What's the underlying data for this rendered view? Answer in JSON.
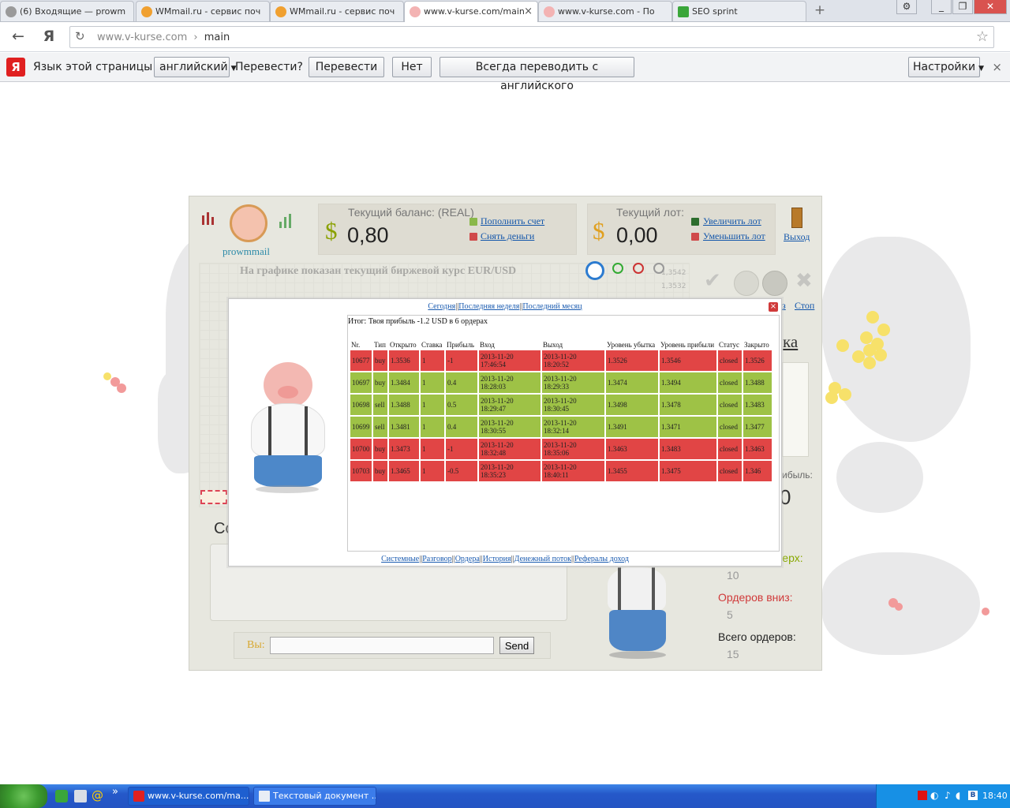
{
  "browser": {
    "tabs": [
      {
        "label": "(6) Входящие — prowm",
        "icon_color": "#8a8a8a"
      },
      {
        "label": "WMmail.ru - сервис поч",
        "icon_color": "#f0a030"
      },
      {
        "label": "WMmail.ru - сервис поч",
        "icon_color": "#f0a030"
      },
      {
        "label": "www.v-kurse.com/main",
        "icon_color": "#f3b3b3",
        "close": "×"
      },
      {
        "label": "www.v-kurse.com - По",
        "icon_color": "#f3b3b3"
      },
      {
        "label": "SEO sprint",
        "icon_color": "#3aa63a"
      }
    ],
    "new_tab": "+",
    "window_buttons": {
      "settings": "⚙",
      "minimize": "_",
      "restore": "❐",
      "close": "✕"
    },
    "nav": {
      "back": "←",
      "yandex": "Я",
      "reload": "↻"
    },
    "address": {
      "host": "www.v-kurse.com",
      "separator": "›",
      "path": "main",
      "star": "☆"
    },
    "translate": {
      "logo": "Я",
      "prompt": "Язык этой страницы –",
      "language": "английский",
      "question": "Перевести?",
      "translate_btn": "Перевести",
      "no_btn": "Нет",
      "always_btn": "Всегда переводить с английского",
      "settings_btn": "Настройки",
      "close": "×"
    }
  },
  "app": {
    "username": "prowmmail",
    "balance": {
      "label": "Текущий баланс: (REAL)",
      "currency": "$",
      "value": "0,80",
      "deposit": "Пополнить счет",
      "withdraw": "Снять деньги"
    },
    "lot": {
      "label": "Текущий лот:",
      "currency": "$",
      "value": "0,00",
      "increase": "Увеличить лот",
      "decrease": "Уменьшить лот"
    },
    "exit": "Выход",
    "chart_title": "На графике показан текущий биржевой курс EUR/USD",
    "price_ticks": [
      "1,3542",
      "1,3532"
    ],
    "partial_right_link": "Стоп",
    "partial_right_link2": "з",
    "partial_heading": "ка",
    "partial_profit_label": "ибыль:",
    "partial_profit_value": "0",
    "chat_heading_partial": "Со",
    "chat_you_label": "Вы:",
    "chat_send": "Send",
    "orders_up_label": "верх:",
    "orders_up_value": "10",
    "orders_down_label": "Ордеров вниз:",
    "orders_down_value": "5",
    "orders_total_label": "Всего ордеров:",
    "orders_total_value": "15"
  },
  "modal": {
    "periods": [
      "Сегодня",
      "Последняя неделя",
      "Последний месяц"
    ],
    "close": "×",
    "summary": "Итог: Твоя прибыль -1.2 USD в 6 ордерах",
    "columns": [
      "Nr.",
      "Тип",
      "Открыто",
      "Ставка",
      "Прибыль",
      "Вход",
      "Выход",
      "Уровень убытка",
      "Уровень прибыли",
      "Статус",
      "Закрыто"
    ],
    "rows": [
      {
        "result": "loss",
        "nr": "10677",
        "type": "buy",
        "open": "1.3536",
        "stake": "1",
        "profit": "-1",
        "entry": "2013-11-20 17:46:54",
        "exit": "2013-11-20 18:20:52",
        "stop_loss": "1.3526",
        "take_profit": "1.3546",
        "status": "closed",
        "closed": "1.3526"
      },
      {
        "result": "win",
        "nr": "10697",
        "type": "buy",
        "open": "1.3484",
        "stake": "1",
        "profit": "0.4",
        "entry": "2013-11-20 18:28:03",
        "exit": "2013-11-20 18:29:33",
        "stop_loss": "1.3474",
        "take_profit": "1.3494",
        "status": "closed",
        "closed": "1.3488"
      },
      {
        "result": "win",
        "nr": "10698",
        "type": "sell",
        "open": "1.3488",
        "stake": "1",
        "profit": "0.5",
        "entry": "2013-11-20 18:29:47",
        "exit": "2013-11-20 18:30:45",
        "stop_loss": "1.3498",
        "take_profit": "1.3478",
        "status": "closed",
        "closed": "1.3483"
      },
      {
        "result": "win",
        "nr": "10699",
        "type": "sell",
        "open": "1.3481",
        "stake": "1",
        "profit": "0.4",
        "entry": "2013-11-20 18:30:55",
        "exit": "2013-11-20 18:32:14",
        "stop_loss": "1.3491",
        "take_profit": "1.3471",
        "status": "closed",
        "closed": "1.3477"
      },
      {
        "result": "loss",
        "nr": "10700",
        "type": "buy",
        "open": "1.3473",
        "stake": "1",
        "profit": "-1",
        "entry": "2013-11-20 18:32:48",
        "exit": "2013-11-20 18:35:06",
        "stop_loss": "1.3463",
        "take_profit": "1.3483",
        "status": "closed",
        "closed": "1.3463"
      },
      {
        "result": "loss",
        "nr": "10703",
        "type": "buy",
        "open": "1.3465",
        "stake": "1",
        "profit": "-0.5",
        "entry": "2013-11-20 18:35:23",
        "exit": "2013-11-20 18:40:11",
        "stop_loss": "1.3455",
        "take_profit": "1.3475",
        "status": "closed",
        "closed": "1.346"
      }
    ],
    "footer_links": [
      "Системные",
      "Разговор",
      "Ордера",
      "История",
      "Денежный поток",
      "Рефералы доход"
    ]
  },
  "taskbar": {
    "tasks": [
      {
        "label": "www.v-kurse.com/ma..."
      },
      {
        "label": "Текстовый документ ..."
      }
    ],
    "quick_more": "»",
    "lang": "RU",
    "clock": "18:40"
  },
  "colors": {
    "loss_row": "#e14545",
    "win_row": "#9ec246",
    "link": "#1a5bb0",
    "accent_red": "#cc3333"
  }
}
